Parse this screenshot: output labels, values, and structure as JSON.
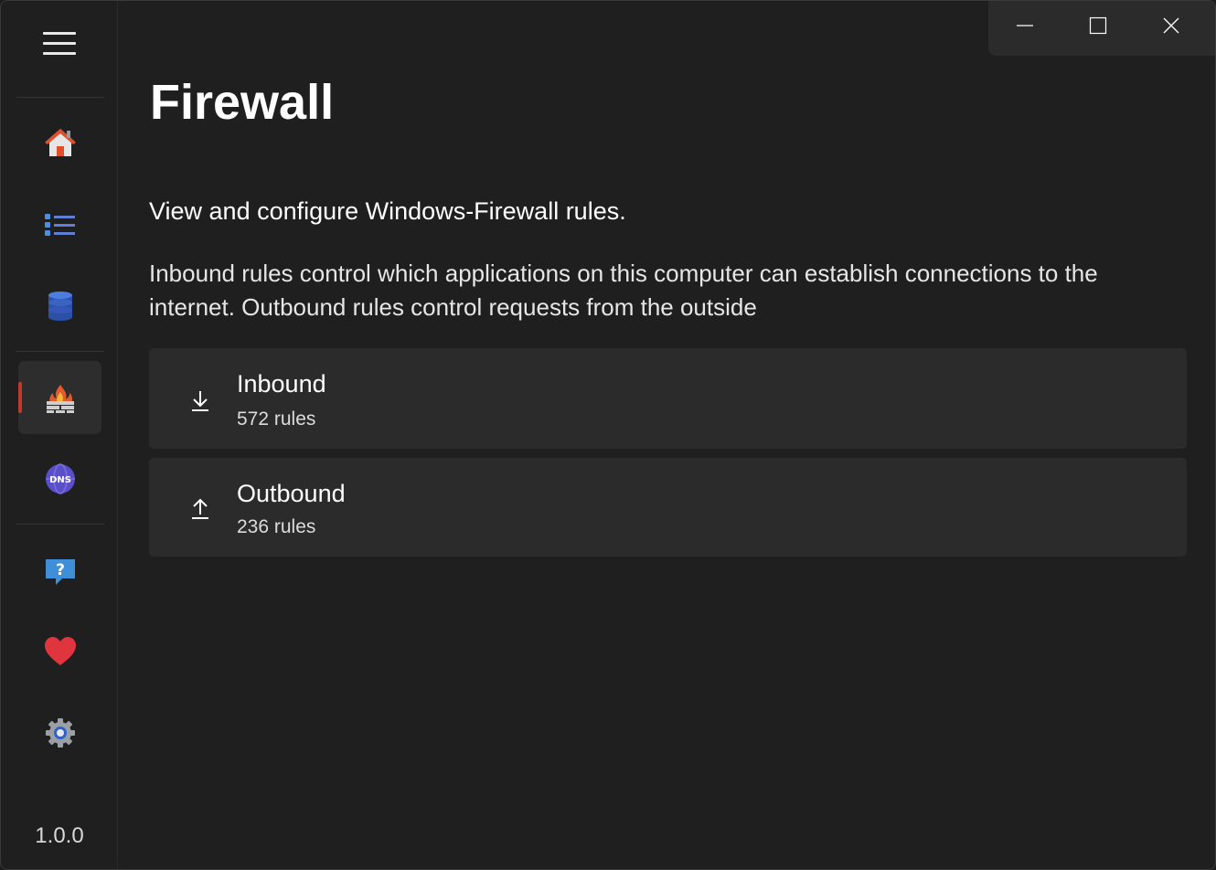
{
  "window": {
    "controls": {
      "minimize_icon": "minimize-icon",
      "maximize_icon": "maximize-icon",
      "close_icon": "close-icon"
    }
  },
  "sidebar": {
    "menu_icon": "hamburger-menu-icon",
    "items": [
      {
        "name": "home",
        "icon": "house-icon",
        "active": false
      },
      {
        "name": "list",
        "icon": "bulleted-list-icon",
        "active": false
      },
      {
        "name": "database",
        "icon": "database-icon",
        "active": false
      },
      {
        "name": "firewall",
        "icon": "firewall-icon",
        "active": true
      },
      {
        "name": "dns",
        "icon": "dns-globe-icon",
        "active": false
      },
      {
        "name": "help",
        "icon": "question-chat-icon",
        "active": false
      },
      {
        "name": "favorites",
        "icon": "heart-icon",
        "active": false
      },
      {
        "name": "settings",
        "icon": "gear-icon",
        "active": false
      }
    ],
    "version": "1.0.0"
  },
  "main": {
    "title": "Firewall",
    "subtitle": "View and configure Windows-Firewall rules.",
    "description": "Inbound rules control which applications on this computer can establish connections to the internet. Outbound rules control requests from the outside",
    "cards": [
      {
        "title": "Inbound",
        "subtitle": "572 rules",
        "icon": "download-arrow-icon"
      },
      {
        "title": "Outbound",
        "subtitle": "236 rules",
        "icon": "upload-arrow-icon"
      }
    ]
  },
  "colors": {
    "background": "#1f1f1f",
    "card": "#2b2b2b",
    "active_indicator": "#c0392b",
    "text": "#ffffff"
  }
}
